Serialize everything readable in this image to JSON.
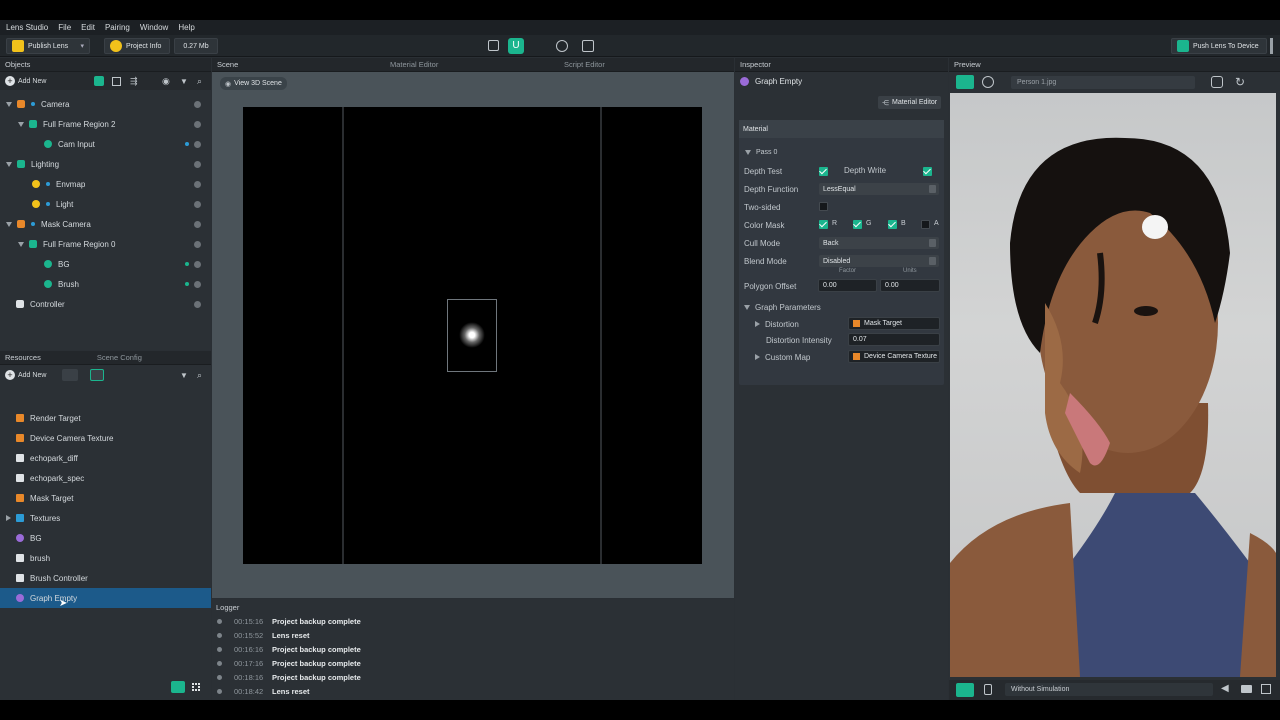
{
  "menu": [
    "Lens Studio",
    "File",
    "Edit",
    "Pairing",
    "Window",
    "Help"
  ],
  "toolbar": {
    "publish": "Publish Lens",
    "project_info": "Project Info",
    "size": "0.27 Mb",
    "push": "Push Lens To Device"
  },
  "objects": {
    "title": "Objects",
    "add_new": "Add New",
    "items": [
      {
        "label": "Camera"
      },
      {
        "label": "Full Frame Region 2"
      },
      {
        "label": "Cam Input"
      },
      {
        "label": "Lighting"
      },
      {
        "label": "Envmap"
      },
      {
        "label": "Light"
      },
      {
        "label": "Mask Camera"
      },
      {
        "label": "Full Frame Region 0"
      },
      {
        "label": "BG"
      },
      {
        "label": "Brush"
      },
      {
        "label": "Controller"
      }
    ]
  },
  "resources": {
    "tab1": "Resources",
    "tab2": "Scene Config",
    "add_new": "Add New",
    "items": [
      {
        "label": "Render Target"
      },
      {
        "label": "Device Camera Texture"
      },
      {
        "label": "echopark_diff"
      },
      {
        "label": "echopark_spec"
      },
      {
        "label": "Mask Target"
      },
      {
        "label": "Textures"
      },
      {
        "label": "BG"
      },
      {
        "label": "brush"
      },
      {
        "label": "Brush Controller"
      },
      {
        "label": "Graph Empty"
      }
    ]
  },
  "scene": {
    "tab": "Scene",
    "tab2": "Material Editor",
    "tab3": "Script Editor",
    "view3d": "View 3D Scene"
  },
  "logger": {
    "title": "Logger",
    "entries": [
      {
        "time": "00:15:16",
        "msg": "Project backup complete"
      },
      {
        "time": "00:15:52",
        "msg": "Lens reset"
      },
      {
        "time": "00:16:16",
        "msg": "Project backup complete"
      },
      {
        "time": "00:17:16",
        "msg": "Project backup complete"
      },
      {
        "time": "00:18:16",
        "msg": "Project backup complete"
      },
      {
        "time": "00:18:42",
        "msg": "Lens reset"
      }
    ]
  },
  "inspector": {
    "title": "Inspector",
    "object": "Graph Empty",
    "material_editor": "Material Editor",
    "section": "Material",
    "pass": "Pass 0",
    "depth_test": "Depth Test",
    "depth_write": "Depth Write",
    "depth_function": "Depth Function",
    "depth_function_val": "LessEqual",
    "two_sided": "Two-sided",
    "color_mask": "Color Mask",
    "r": "R",
    "g": "G",
    "b": "B",
    "a": "A",
    "cull_mode": "Cull Mode",
    "cull_mode_val": "Back",
    "blend_mode": "Blend Mode",
    "blend_mode_val": "Disabled",
    "factor": "Factor",
    "units": "Units",
    "polygon_offset": "Polygon Offset",
    "po_factor": "0.00",
    "po_units": "0.00",
    "graph_params": "Graph Parameters",
    "distortion": "Distortion",
    "distortion_val": "Mask Target",
    "distortion_intensity": "Distortion Intensity",
    "distortion_intensity_val": "0.07",
    "custom_map": "Custom Map",
    "custom_map_val": "Device Camera Texture"
  },
  "preview": {
    "title": "Preview",
    "file": "Person 1.jpg",
    "simulation": "Without Simulation"
  },
  "colors": {
    "accent": "#1bb58e",
    "selection": "#1c5a8a"
  }
}
